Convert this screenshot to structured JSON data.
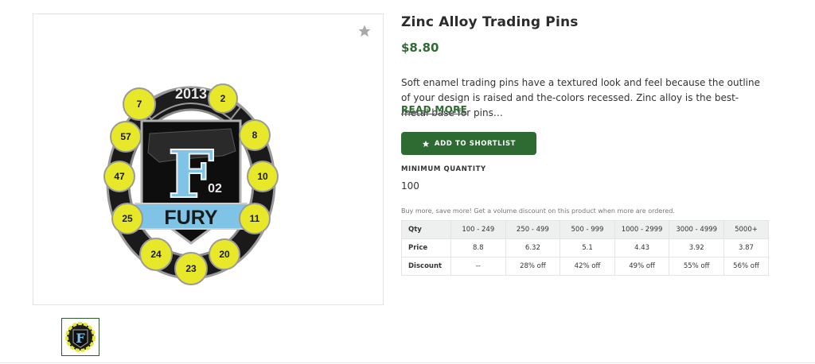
{
  "product": {
    "title": "Zinc Alloy Trading Pins",
    "price": "$8.80",
    "description": "Soft enamel trading pins have a textured look and feel because the outline of your design is raised and the-colors recessed. Zinc alloy is the best-metal base for pins…",
    "read_more": "READ MORE",
    "add_to_shortlist": "ADD TO SHORTLIST",
    "min_qty_label": "MINIMUM QUANTITY",
    "min_qty_value": "100",
    "volume_note": "Buy more, save more! Get a volume discount on this product when more are ordered."
  },
  "pin_artwork": {
    "year": "2013",
    "letter": "F",
    "number": "02",
    "team": "FURY",
    "ball_numbers": [
      "7",
      "2",
      "8",
      "10",
      "11",
      "20",
      "23",
      "24",
      "25",
      "47",
      "57"
    ]
  },
  "tiers": {
    "header": [
      "Qty",
      "100 - 249",
      "250 - 499",
      "500 - 999",
      "1000 - 2999",
      "3000 - 4999",
      "5000+"
    ],
    "price": [
      "Price",
      "8.8",
      "6.32",
      "5.1",
      "4.43",
      "3.92",
      "3.87"
    ],
    "discount": [
      "Discount",
      "--",
      "28% off",
      "42% off",
      "49% off",
      "55% off",
      "56% off"
    ]
  },
  "icons": {
    "favorite": "star-icon",
    "shortlist": "star-icon"
  },
  "colors": {
    "accent": "#2e6b33",
    "ball": "#e8e82a",
    "enamel_blue": "#7fc4e6"
  }
}
